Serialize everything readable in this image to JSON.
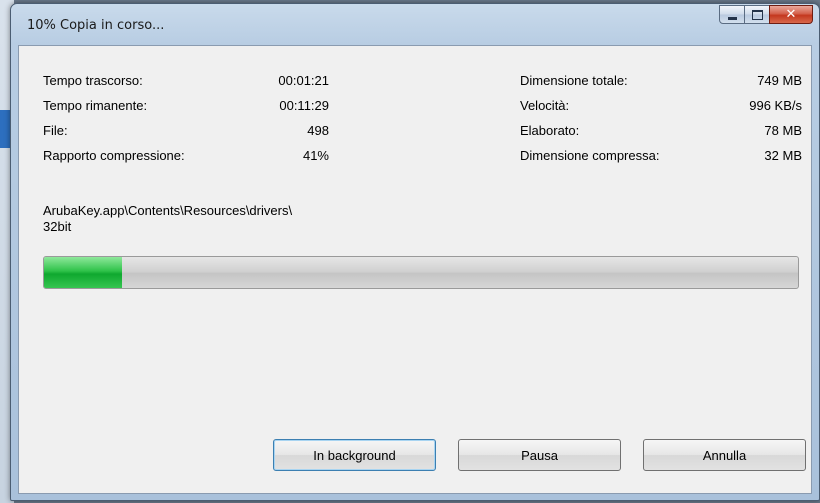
{
  "window": {
    "title": "10% Copia in corso...",
    "controls": {
      "minimize": "minimize-icon",
      "maximize": "maximize-icon",
      "close": "close-icon"
    }
  },
  "stats_left": [
    {
      "label": "Tempo trascorso:",
      "value": "00:01:21"
    },
    {
      "label": "Tempo rimanente:",
      "value": "00:11:29"
    },
    {
      "label": "File:",
      "value": "498"
    },
    {
      "label": "Rapporto compressione:",
      "value": "41%"
    }
  ],
  "stats_right": [
    {
      "label": "Dimensione totale:",
      "value": "749 MB"
    },
    {
      "label": "Velocità:",
      "value": "996 KB/s"
    },
    {
      "label": "Elaborato:",
      "value": "78 MB"
    },
    {
      "label": "Dimensione compressa:",
      "value": "32 MB"
    }
  ],
  "current_path": {
    "line1": "ArubaKey.app\\Contents\\Resources\\drivers\\",
    "line2": "32bit"
  },
  "progress": {
    "percent": 10.4,
    "fill_color": "#1fb63f"
  },
  "buttons": {
    "background": "In background",
    "pause": "Pausa",
    "cancel": "Annulla"
  }
}
